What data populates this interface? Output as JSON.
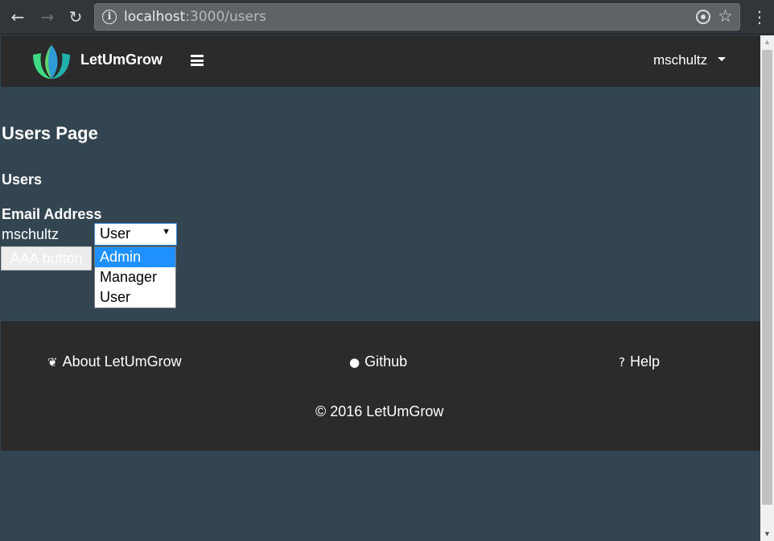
{
  "browser": {
    "url_host": "localhost",
    "url_path": ":3000/users"
  },
  "navbar": {
    "brand": "LetUmGrow",
    "user": "mschultz"
  },
  "main": {
    "page_title": "Users Page",
    "section_title": "Users",
    "table": {
      "column_header": "Email Address",
      "rows": [
        {
          "email": "mschultz",
          "role": "User"
        }
      ]
    },
    "role_select": {
      "value": "User",
      "options": [
        "Admin",
        "Manager",
        "User"
      ],
      "highlighted": "Admin"
    },
    "button_label": "AAA button"
  },
  "footer": {
    "about": "About LetUmGrow",
    "github": "Github",
    "help": "Help",
    "copyright": "© 2016 LetUmGrow"
  },
  "colors": {
    "page_bg": "#324550",
    "navbar_bg": "#2b2b2b",
    "highlight": "#1e90ff"
  }
}
